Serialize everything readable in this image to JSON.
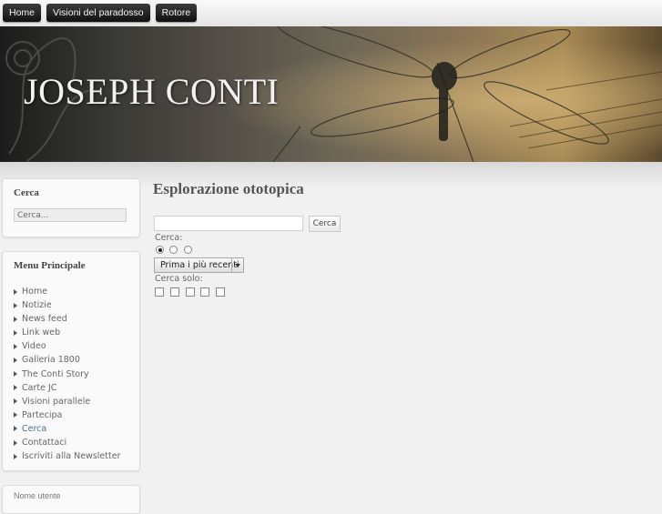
{
  "topnav": [
    "Home",
    "Visioni del paradosso",
    "Rotore"
  ],
  "banner": {
    "title": "JOSEPH CONTI"
  },
  "search_module": {
    "title": "Cerca",
    "placeholder": "Cerca..."
  },
  "menu_module": {
    "title": "Menu Principale",
    "items": [
      "Home",
      "Notizie",
      "News feed",
      "Link web",
      "Video",
      "Galleria 1800",
      "The Conti Story",
      "Carte JC",
      "Visioni parallele",
      "Partecipa",
      "Cerca",
      "Contattaci",
      "Iscriviti alla Newsletter"
    ],
    "active_index": 10
  },
  "bottom_module": {
    "title": "Nome utente"
  },
  "main": {
    "title": "Esplorazione ototopica",
    "search_button": "Cerca",
    "search_for_label": "Cerca:",
    "radio_selected_index": 0,
    "ordering_value": "Prima i più recenti",
    "search_only_label": "Cerca solo:"
  },
  "colors": {
    "active_link": "#4a6f96",
    "nav_bg": "#1a1a1a"
  }
}
